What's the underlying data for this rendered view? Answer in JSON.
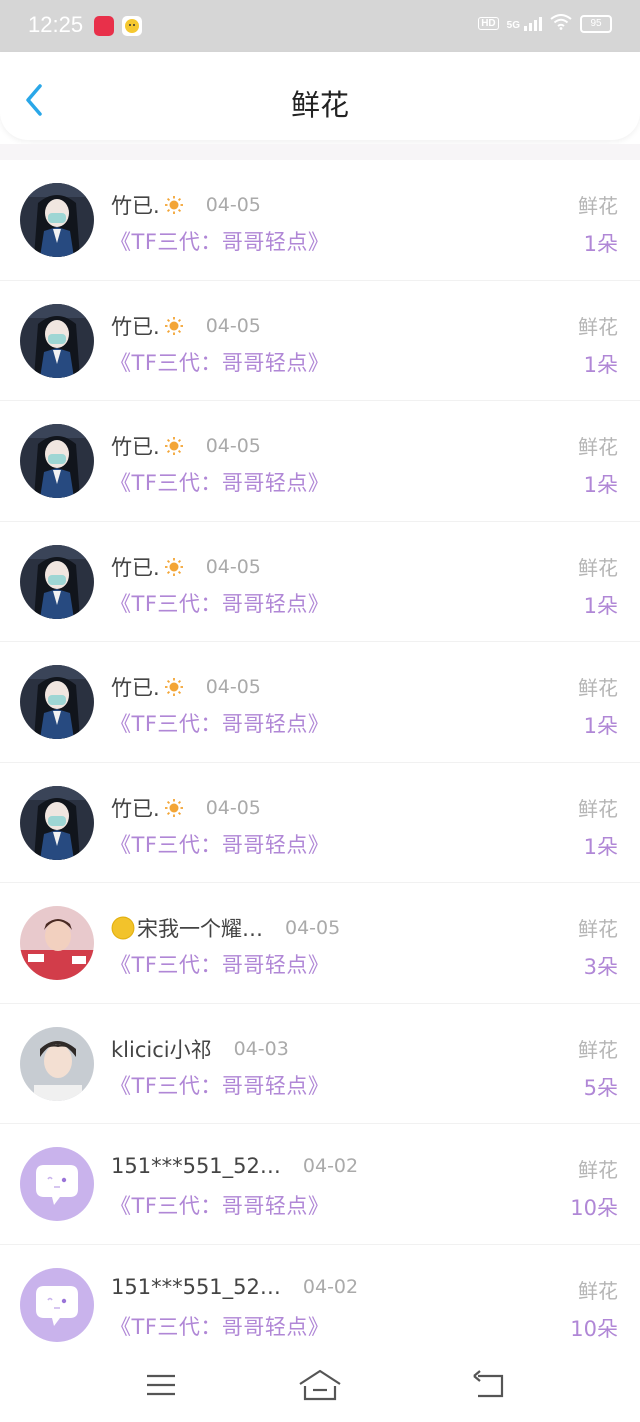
{
  "status": {
    "time": "12:25",
    "network": "5G",
    "battery": "95",
    "hd": "HD"
  },
  "header": {
    "title": "鲜花"
  },
  "colors": {
    "accent": "#b087d6",
    "back_icon": "#2aa7e8"
  },
  "rows": [
    {
      "name": "竹已.",
      "badge": "sun-icon",
      "date": "04-05",
      "work": "《TF三代：哥哥轻点》",
      "label": "鲜花",
      "count": "1朵",
      "avatar": "anime-girl-avatar"
    },
    {
      "name": "竹已.",
      "badge": "sun-icon",
      "date": "04-05",
      "work": "《TF三代：哥哥轻点》",
      "label": "鲜花",
      "count": "1朵",
      "avatar": "anime-girl-avatar"
    },
    {
      "name": "竹已.",
      "badge": "sun-icon",
      "date": "04-05",
      "work": "《TF三代：哥哥轻点》",
      "label": "鲜花",
      "count": "1朵",
      "avatar": "anime-girl-avatar"
    },
    {
      "name": "竹已.",
      "badge": "sun-icon",
      "date": "04-05",
      "work": "《TF三代：哥哥轻点》",
      "label": "鲜花",
      "count": "1朵",
      "avatar": "anime-girl-avatar"
    },
    {
      "name": "竹已.",
      "badge": "sun-icon",
      "date": "04-05",
      "work": "《TF三代：哥哥轻点》",
      "label": "鲜花",
      "count": "1朵",
      "avatar": "anime-girl-avatar"
    },
    {
      "name": "竹已.",
      "badge": "sun-icon",
      "date": "04-05",
      "work": "《TF三代：哥哥轻点》",
      "label": "鲜花",
      "count": "1朵",
      "avatar": "anime-girl-avatar"
    },
    {
      "name": "宋我一个耀…",
      "badge": "moon-icon",
      "date": "04-05",
      "work": "《TF三代：哥哥轻点》",
      "label": "鲜花",
      "count": "3朵",
      "avatar": "photo-avatar-red"
    },
    {
      "name": "klicici小祁",
      "badge": "",
      "date": "04-03",
      "work": "《TF三代：哥哥轻点》",
      "label": "鲜花",
      "count": "5朵",
      "avatar": "photo-avatar-boy"
    },
    {
      "name": "151***551_52…",
      "badge": "",
      "date": "04-02",
      "work": "《TF三代：哥哥轻点》",
      "label": "鲜花",
      "count": "10朵",
      "avatar": "default-chat-avatar"
    },
    {
      "name": "151***551_52…",
      "badge": "",
      "date": "04-02",
      "work": "《TF三代：哥哥轻点》",
      "label": "鲜花",
      "count": "10朵",
      "avatar": "default-chat-avatar"
    }
  ]
}
